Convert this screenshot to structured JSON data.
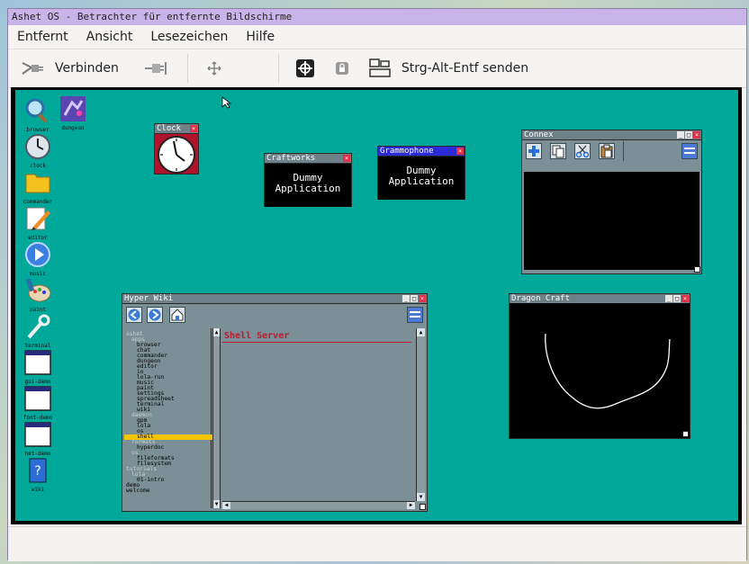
{
  "window": {
    "title": "Ashet OS - Betrachter für entfernte Bildschirme"
  },
  "menu": [
    "Entfernt",
    "Ansicht",
    "Lesezeichen",
    "Hilfe"
  ],
  "toolbar": {
    "connect_label": "Verbinden",
    "cad_label": "Strg-Alt-Entf senden"
  },
  "desktop_icons": [
    {
      "label": "browser",
      "icon": "magnifier-icon"
    },
    {
      "label": "dungeon",
      "icon": "dungeon-icon"
    },
    {
      "label": "clock",
      "icon": "clock-icon"
    },
    {
      "label": "commander",
      "icon": "folder-icon"
    },
    {
      "label": "editor",
      "icon": "pencil-icon"
    },
    {
      "label": "music",
      "icon": "play-icon"
    },
    {
      "label": "paint",
      "icon": "paint-icon"
    },
    {
      "label": "terminal",
      "icon": "wrench-icon"
    },
    {
      "label": "gui-demo",
      "icon": "window-icon"
    },
    {
      "label": "font-demo",
      "icon": "window-icon"
    },
    {
      "label": "net-demo",
      "icon": "window-icon"
    },
    {
      "label": "wiki",
      "icon": "book-icon"
    }
  ],
  "windows": {
    "clock": {
      "title": "Clock"
    },
    "craftworks": {
      "title": "Craftworks",
      "body_line1": "Dummy",
      "body_line2": "Application"
    },
    "grammophone": {
      "title": "Grammophone",
      "body_line1": "Dummy",
      "body_line2": "Application"
    },
    "connex": {
      "title": "Connex"
    },
    "hyperwiki": {
      "title": "Hyper Wiki",
      "heading": "Shell Server",
      "tree": [
        {
          "text": "ashet",
          "indent": 0,
          "cat": true
        },
        {
          "text": "apps",
          "indent": 1,
          "cat": true
        },
        {
          "text": "browser",
          "indent": 2
        },
        {
          "text": "chat",
          "indent": 2
        },
        {
          "text": "commander",
          "indent": 2
        },
        {
          "text": "dungeon",
          "indent": 2
        },
        {
          "text": "editor",
          "indent": 2
        },
        {
          "text": "io",
          "indent": 2
        },
        {
          "text": "lola-run",
          "indent": 2
        },
        {
          "text": "music",
          "indent": 2
        },
        {
          "text": "paint",
          "indent": 2
        },
        {
          "text": "settings",
          "indent": 2
        },
        {
          "text": "spreadsheet",
          "indent": 2
        },
        {
          "text": "terminal",
          "indent": 2
        },
        {
          "text": "wiki",
          "indent": 2
        },
        {
          "text": "daemon",
          "indent": 1,
          "cat": true
        },
        {
          "text": "gpm",
          "indent": 2
        },
        {
          "text": "lola",
          "indent": 2
        },
        {
          "text": "os",
          "indent": 2
        },
        {
          "text": "shell",
          "indent": 2,
          "selected": true
        },
        {
          "text": "formats",
          "indent": 1,
          "cat": true
        },
        {
          "text": "hyperdoc",
          "indent": 2
        },
        {
          "text": "os",
          "indent": 1,
          "cat": true
        },
        {
          "text": "fileformats",
          "indent": 2
        },
        {
          "text": "filesystem",
          "indent": 2
        },
        {
          "text": "tutorials",
          "indent": 0,
          "cat": true
        },
        {
          "text": "lola",
          "indent": 1,
          "cat": true
        },
        {
          "text": "01-intro",
          "indent": 2
        },
        {
          "text": "demo",
          "indent": 0
        },
        {
          "text": "welcome",
          "indent": 0
        }
      ]
    },
    "dragoncraft": {
      "title": "Dragon Craft"
    }
  },
  "colors": {
    "desktop": "#00a89a",
    "titlebar": "#c9b4ea",
    "close": "#e0304a",
    "selection": "#f5c400",
    "heading": "#c0182e"
  }
}
